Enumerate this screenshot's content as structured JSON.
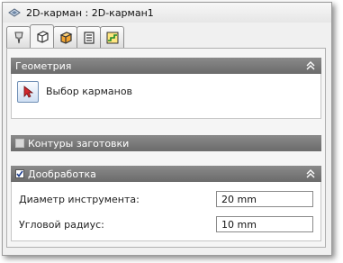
{
  "window": {
    "title": "2D-карман : 2D-карман1"
  },
  "tabs": [
    {
      "icon": "tool-icon",
      "active": false
    },
    {
      "icon": "cube-icon",
      "active": true
    },
    {
      "icon": "cube-orange-icon",
      "active": false
    },
    {
      "icon": "list-icon",
      "active": false
    },
    {
      "icon": "steps-icon",
      "active": false
    }
  ],
  "sections": {
    "geometry": {
      "title": "Геометрия",
      "select_pockets_label": "Выбор карманов",
      "collapse_icon": "collapse-chevron-icon"
    },
    "stock_contours": {
      "title": "Контуры заготовки",
      "checked": false
    },
    "rest_machining": {
      "title": "Дообработка",
      "checked": true,
      "tool_diameter_label": "Диаметр инструмента:",
      "tool_diameter_value": "20 mm",
      "corner_radius_label": "Угловой радиус:",
      "corner_radius_value": "10 mm"
    }
  },
  "colors": {
    "section_header": "#7a7a7a",
    "accent_blue": "#3b6ea8"
  }
}
